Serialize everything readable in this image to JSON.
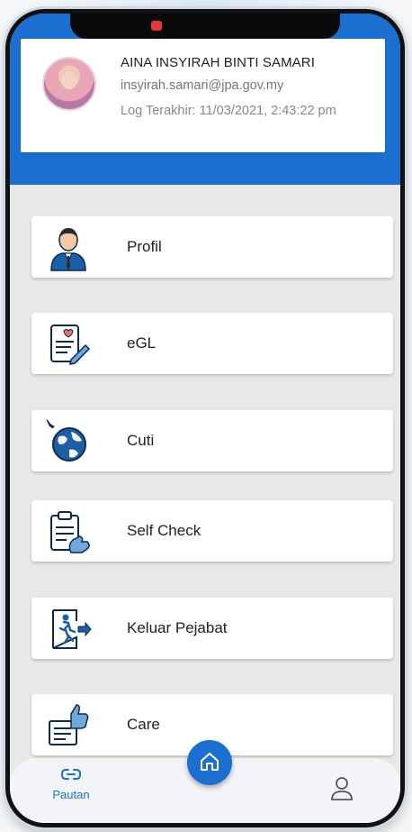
{
  "profile": {
    "name": "AINA INSYIRAH BINTI SAMARI",
    "email": "insyirah.samari@jpa.gov.my",
    "last_login": "Log Terakhir: 11/03/2021, 2:43:22 pm"
  },
  "menu": [
    {
      "label": "Profil",
      "icon": "person-icon"
    },
    {
      "label": "eGL",
      "icon": "document-pen-icon"
    },
    {
      "label": "Cuti",
      "icon": "globe-plane-icon"
    },
    {
      "label": "Self Check",
      "icon": "clipboard-hand-icon"
    },
    {
      "label": "Keluar Pejabat",
      "icon": "exit-door-icon"
    },
    {
      "label": "Care",
      "icon": "thumbs-up-document-icon"
    }
  ],
  "bottom_nav": {
    "pautan_label": "Pautan",
    "home_icon": "home-icon",
    "profile_icon": "user-icon"
  },
  "colors": {
    "primary": "#1a6fd1",
    "background": "#e8e8e8",
    "card": "#ffffff"
  }
}
